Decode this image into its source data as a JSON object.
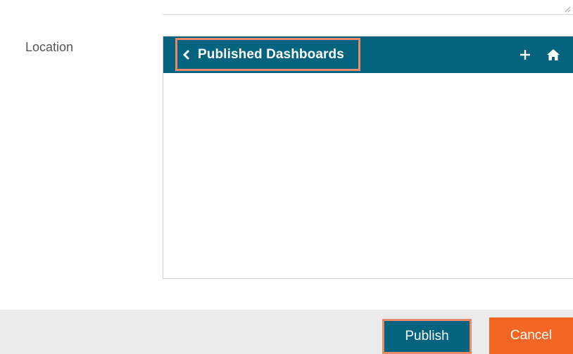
{
  "form": {
    "location_label": "Location"
  },
  "location_browser": {
    "breadcrumb_label": "Published Dashboards",
    "back_icon": "chevron-left-icon",
    "add_icon": "plus-icon",
    "home_icon": "home-icon",
    "header_color": "#04647f",
    "highlight_color": "#ea8a68"
  },
  "footer": {
    "publish_label": "Publish",
    "cancel_label": "Cancel",
    "publish_color": "#04647f",
    "cancel_color": "#f26522"
  }
}
